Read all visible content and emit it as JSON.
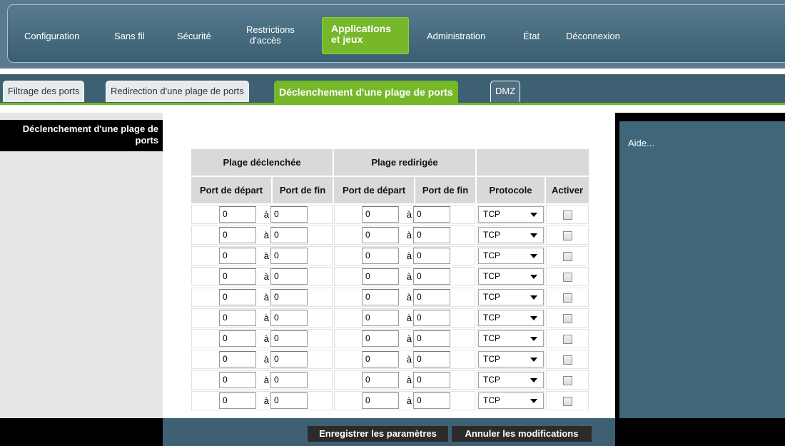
{
  "nav": {
    "items": [
      {
        "label": "Configuration"
      },
      {
        "label": "Sans fil"
      },
      {
        "label": "Sécurité"
      },
      {
        "label_line1": "Restrictions",
        "label_line2": "d'accès"
      },
      {
        "label_line1": "Applications",
        "label_line2": "et jeux",
        "active": true
      },
      {
        "label": "Administration"
      },
      {
        "label": "État"
      },
      {
        "label": "Déconnexion"
      }
    ]
  },
  "subtabs": [
    {
      "label": "Filtrage des ports"
    },
    {
      "label": "Redirection d'une plage de ports"
    },
    {
      "label": "Déclenchement d'une plage de ports",
      "active": true
    },
    {
      "label": "DMZ"
    }
  ],
  "section_title": "Déclenchement d'une plage de ports",
  "table": {
    "group_triggered": "Plage déclenchée",
    "group_redirected": "Plage redirigée",
    "col_start": "Port de départ",
    "col_end": "Port de fin",
    "col_protocol": "Protocole",
    "col_enable": "Activer",
    "separator": "à",
    "rows": [
      {
        "t_start": "0",
        "t_end": "0",
        "r_start": "0",
        "r_end": "0",
        "protocol": "TCP",
        "enabled": false
      },
      {
        "t_start": "0",
        "t_end": "0",
        "r_start": "0",
        "r_end": "0",
        "protocol": "TCP",
        "enabled": false
      },
      {
        "t_start": "0",
        "t_end": "0",
        "r_start": "0",
        "r_end": "0",
        "protocol": "TCP",
        "enabled": false
      },
      {
        "t_start": "0",
        "t_end": "0",
        "r_start": "0",
        "r_end": "0",
        "protocol": "TCP",
        "enabled": false
      },
      {
        "t_start": "0",
        "t_end": "0",
        "r_start": "0",
        "r_end": "0",
        "protocol": "TCP",
        "enabled": false
      },
      {
        "t_start": "0",
        "t_end": "0",
        "r_start": "0",
        "r_end": "0",
        "protocol": "TCP",
        "enabled": false
      },
      {
        "t_start": "0",
        "t_end": "0",
        "r_start": "0",
        "r_end": "0",
        "protocol": "TCP",
        "enabled": false
      },
      {
        "t_start": "0",
        "t_end": "0",
        "r_start": "0",
        "r_end": "0",
        "protocol": "TCP",
        "enabled": false
      },
      {
        "t_start": "0",
        "t_end": "0",
        "r_start": "0",
        "r_end": "0",
        "protocol": "TCP",
        "enabled": false
      },
      {
        "t_start": "0",
        "t_end": "0",
        "r_start": "0",
        "r_end": "0",
        "protocol": "TCP",
        "enabled": false
      }
    ]
  },
  "help": {
    "label": "Aide..."
  },
  "footer": {
    "save_label": "Enregistrer les paramètres",
    "cancel_label": "Annuler les modifications"
  },
  "colors": {
    "accent": "#76b82a",
    "nav_bg": "#3e6073",
    "help_bg": "#3f6779"
  }
}
